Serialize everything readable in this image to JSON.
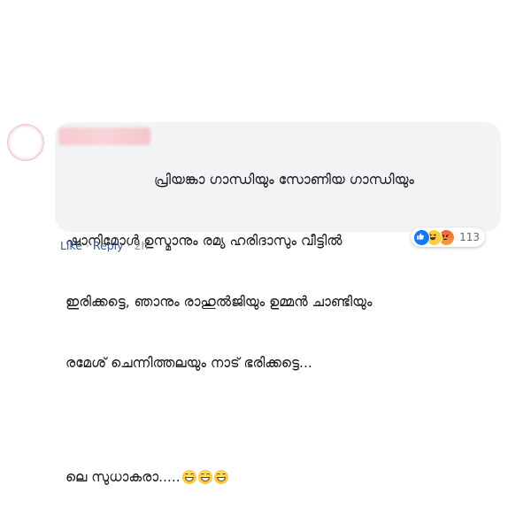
{
  "comment": {
    "lines": [
      "പ്രിയങ്കാ ഗാന്ധിയും സോണിയ ഗാന്ധിയും",
      "ഷാനിമോൾ ഉസ്മാനും രമ്യ ഹരിദാസും വീട്ടിൽ",
      "ഇരിക്കട്ടെ, ഞാനും രാഹുൽജിയും ഉമ്മൻ ചാണ്ടിയും",
      "രമേശ് ചെന്നിത്തലയും നാട് ഭരിക്കട്ടെ..."
    ],
    "closing": "ലെ സുധാകരാ.....",
    "closing_emoji": "grinning-face-emoji x3"
  },
  "reactions": {
    "icons": [
      "like-reaction-icon",
      "haha-reaction-icon",
      "angry-reaction-icon"
    ],
    "count": "113"
  },
  "actions": {
    "like": "Like",
    "reply": "Reply",
    "time": "2h",
    "separator": "·"
  },
  "colors": {
    "bubble": "#f2f3f5",
    "link": "#385898",
    "like_blue": "#1877f2"
  }
}
